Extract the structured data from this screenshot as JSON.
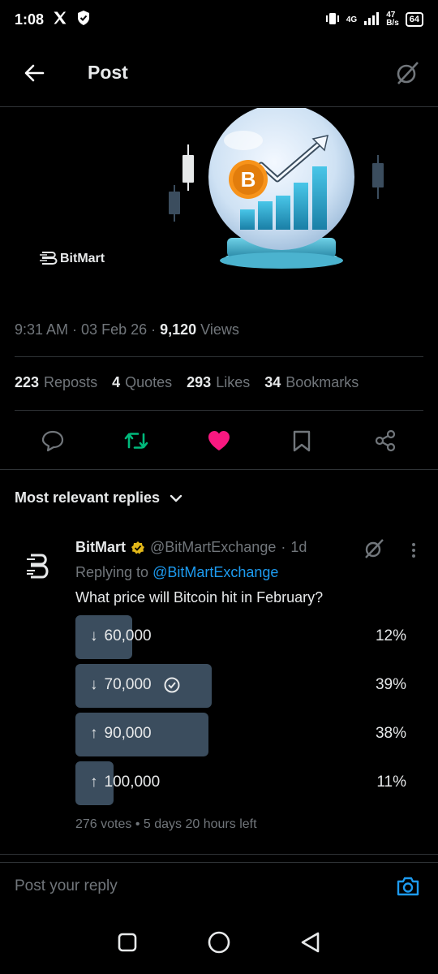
{
  "status": {
    "time": "1:08",
    "network": "4G",
    "speed_value": "47",
    "speed_unit": "B/s",
    "battery": "64"
  },
  "header": {
    "title": "Post"
  },
  "media": {
    "brand_label": "BitMart",
    "coin_symbol": "B"
  },
  "post": {
    "time": "9:31 AM",
    "date": "03 Feb 26",
    "views_count": "9,120",
    "views_label": "Views"
  },
  "stats": {
    "reposts_count": "223",
    "reposts_label": "Reposts",
    "quotes_count": "4",
    "quotes_label": "Quotes",
    "likes_count": "293",
    "likes_label": "Likes",
    "bookmarks_count": "34",
    "bookmarks_label": "Bookmarks"
  },
  "replies": {
    "filter_label": "Most relevant replies"
  },
  "reply": {
    "name": "BitMart",
    "handle": "@BitMartExchange",
    "age": "1d",
    "replying_prefix": "Replying to",
    "replying_handle": "@BitMartExchange",
    "text": "What price will Bitcoin hit in February?",
    "poll": {
      "options": [
        {
          "arrow": "↓",
          "label": "60,000",
          "percent": "12%",
          "fraction": 0.17,
          "selected": false
        },
        {
          "arrow": "↓",
          "label": "70,000",
          "percent": "39%",
          "fraction": 0.41,
          "selected": true
        },
        {
          "arrow": "↑",
          "label": "90,000",
          "percent": "38%",
          "fraction": 0.4,
          "selected": false
        },
        {
          "arrow": "↑",
          "label": "100,000",
          "percent": "11%",
          "fraction": 0.115,
          "selected": false
        }
      ],
      "votes": "276 votes",
      "time_left": "5 days 20 hours left"
    }
  },
  "composer": {
    "placeholder": "Post your reply"
  },
  "colors": {
    "background": "#000000",
    "accent_blue": "#1d9bf0",
    "repost_green": "#00ba7c",
    "like_pink": "#f91880",
    "poll_fill": "#3b4d5e",
    "verified_gold": "#e2b719"
  }
}
